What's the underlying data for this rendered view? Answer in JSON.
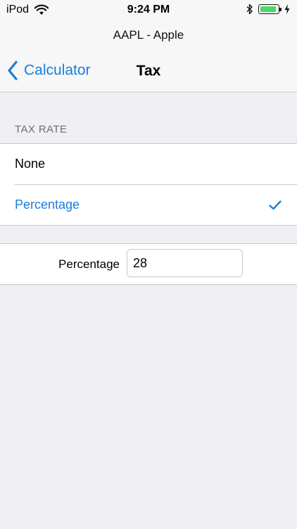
{
  "status_bar": {
    "carrier": "iPod",
    "time": "9:24 PM",
    "battery_level": 0.9,
    "icons": [
      "wifi-icon",
      "bluetooth-icon",
      "battery-icon",
      "charging-bolt-icon"
    ]
  },
  "header": {
    "subtitle": "AAPL - Apple",
    "back_label": "Calculator",
    "title": "Tax"
  },
  "tax_rate": {
    "section_title": "TAX RATE",
    "options": [
      {
        "label": "None",
        "selected": false
      },
      {
        "label": "Percentage",
        "selected": true
      }
    ]
  },
  "percentage_field": {
    "label": "Percentage",
    "value": "28"
  },
  "colors": {
    "accent": "#1a7ddc",
    "background": "#efeff4",
    "battery": "#4cd964"
  }
}
